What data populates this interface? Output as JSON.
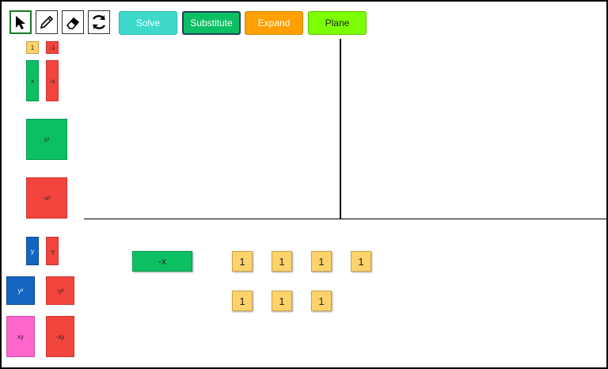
{
  "toolbar": {
    "tools": [
      {
        "name": "pointer-tool",
        "icon": "cursor-arrow-icon",
        "active": true
      },
      {
        "name": "pencil-tool",
        "icon": "pencil-icon",
        "active": false
      },
      {
        "name": "eraser-tool",
        "icon": "eraser-icon",
        "active": false
      },
      {
        "name": "refresh-tool",
        "icon": "refresh-icon",
        "active": false
      }
    ],
    "buttons": {
      "solve": "Solve",
      "substitute": "Substitute",
      "expand": "Expand",
      "plane": "Plane"
    }
  },
  "sidebar": {
    "tiles": {
      "one": "1",
      "neg_one": "-1",
      "x": "x",
      "neg_x": "-x",
      "x2": "x²",
      "neg_x2": "-x²",
      "y": "y",
      "neg_y": "-y",
      "y2": "y²",
      "neg_y2": "-y²",
      "xy": "xy",
      "neg_xy": "-xy"
    }
  },
  "workspace": {
    "neg_x_tile": "-x",
    "unit_tiles": [
      "1",
      "1",
      "1",
      "1",
      "1",
      "1",
      "1"
    ]
  },
  "colors": {
    "yellow": "#ffd36b",
    "green": "#0dbf63",
    "red": "#f2453d",
    "blue": "#1565c0",
    "pink": "#ff66cc",
    "solve": "#3fd9cc",
    "substitute": "#0dbf63",
    "expand": "#ff9f00",
    "plane": "#7cff00"
  }
}
